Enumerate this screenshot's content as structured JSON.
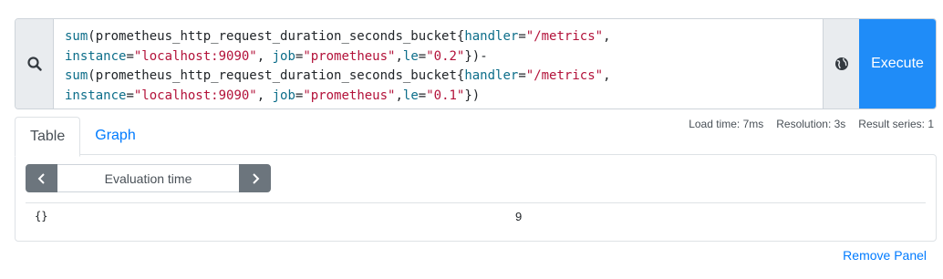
{
  "query": {
    "lines": [
      [
        {
          "t": "sum",
          "c": "fn"
        },
        {
          "t": "(prometheus_http_request_duration_seconds_bucket{",
          "c": ""
        },
        {
          "t": "handler",
          "c": "kw"
        },
        {
          "t": "=",
          "c": ""
        },
        {
          "t": "\"/metrics\"",
          "c": "str"
        },
        {
          "t": ",",
          "c": ""
        }
      ],
      [
        {
          "t": "instance",
          "c": "kw"
        },
        {
          "t": "=",
          "c": ""
        },
        {
          "t": "\"localhost:9090\"",
          "c": "str"
        },
        {
          "t": ", ",
          "c": ""
        },
        {
          "t": "job",
          "c": "kw"
        },
        {
          "t": "=",
          "c": ""
        },
        {
          "t": "\"prometheus\"",
          "c": "str"
        },
        {
          "t": ",",
          "c": ""
        },
        {
          "t": "le",
          "c": "kw"
        },
        {
          "t": "=",
          "c": ""
        },
        {
          "t": "\"0.2\"",
          "c": "str"
        },
        {
          "t": "})-",
          "c": ""
        }
      ],
      [
        {
          "t": "sum",
          "c": "fn"
        },
        {
          "t": "(prometheus_http_request_duration_seconds_bucket{",
          "c": ""
        },
        {
          "t": "handler",
          "c": "kw"
        },
        {
          "t": "=",
          "c": ""
        },
        {
          "t": "\"/metrics\"",
          "c": "str"
        },
        {
          "t": ",",
          "c": ""
        }
      ],
      [
        {
          "t": "instance",
          "c": "kw"
        },
        {
          "t": "=",
          "c": ""
        },
        {
          "t": "\"localhost:9090\"",
          "c": "str"
        },
        {
          "t": ", ",
          "c": ""
        },
        {
          "t": "job",
          "c": "kw"
        },
        {
          "t": "=",
          "c": ""
        },
        {
          "t": "\"prometheus\"",
          "c": "str"
        },
        {
          "t": ",",
          "c": ""
        },
        {
          "t": "le",
          "c": "kw"
        },
        {
          "t": "=",
          "c": ""
        },
        {
          "t": "\"0.1\"",
          "c": "str"
        },
        {
          "t": "})",
          "c": ""
        }
      ]
    ]
  },
  "execute_label": "Execute",
  "tabs": [
    {
      "label": "Table",
      "active": true
    },
    {
      "label": "Graph",
      "active": false
    }
  ],
  "stats": {
    "load_time": "Load time: 7ms",
    "resolution": "Resolution: 3s",
    "result_series": "Result series: 1"
  },
  "eval": {
    "placeholder": "Evaluation time"
  },
  "result": {
    "label": "{}",
    "value": "9"
  },
  "remove_panel": "Remove Panel",
  "icons": {
    "search": "search-icon",
    "globe": "globe-icon",
    "prev": "chevron-left-icon",
    "next": "chevron-right-icon"
  },
  "colors": {
    "accent": "#007bff",
    "execute": "#1f8cf8",
    "nav": "#6c757d",
    "string": "#b3123a",
    "keyword": "#0d6e8a"
  }
}
